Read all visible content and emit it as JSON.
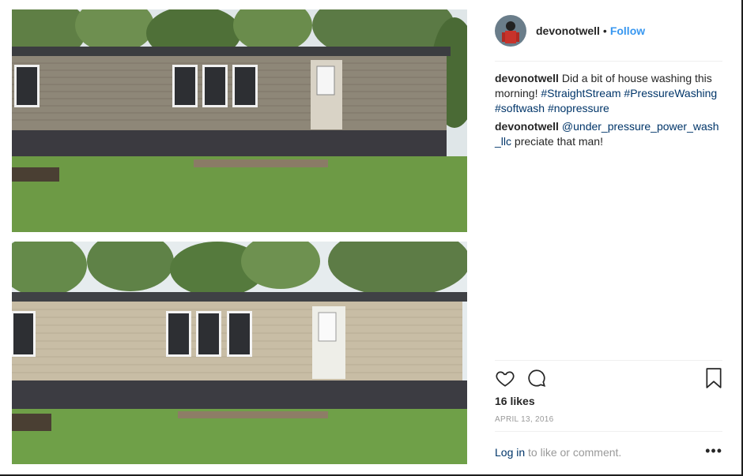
{
  "post": {
    "username": "devonotwell",
    "separator": "•",
    "follow_label": "Follow"
  },
  "comments": [
    {
      "user": "devonotwell",
      "text_before": "Did a bit of house washing this morning! ",
      "tags": [
        "#StraightStream",
        "#PressureWashing",
        "#softwash",
        "#nopressure"
      ]
    },
    {
      "user": "devonotwell",
      "mention": "@under_pressure_power_wash_llc",
      "text_after": "preciate that man!"
    }
  ],
  "likes": "16 likes",
  "date": "APRIL 13, 2016",
  "login": {
    "link": "Log in",
    "text": "to like or comment."
  },
  "more_label": "•••",
  "icons": [
    "heart-icon",
    "comment-icon",
    "bookmark-icon",
    "more-icon"
  ],
  "colors": {
    "link": "#3897f0",
    "hashtag": "#003569",
    "muted": "#999999"
  }
}
